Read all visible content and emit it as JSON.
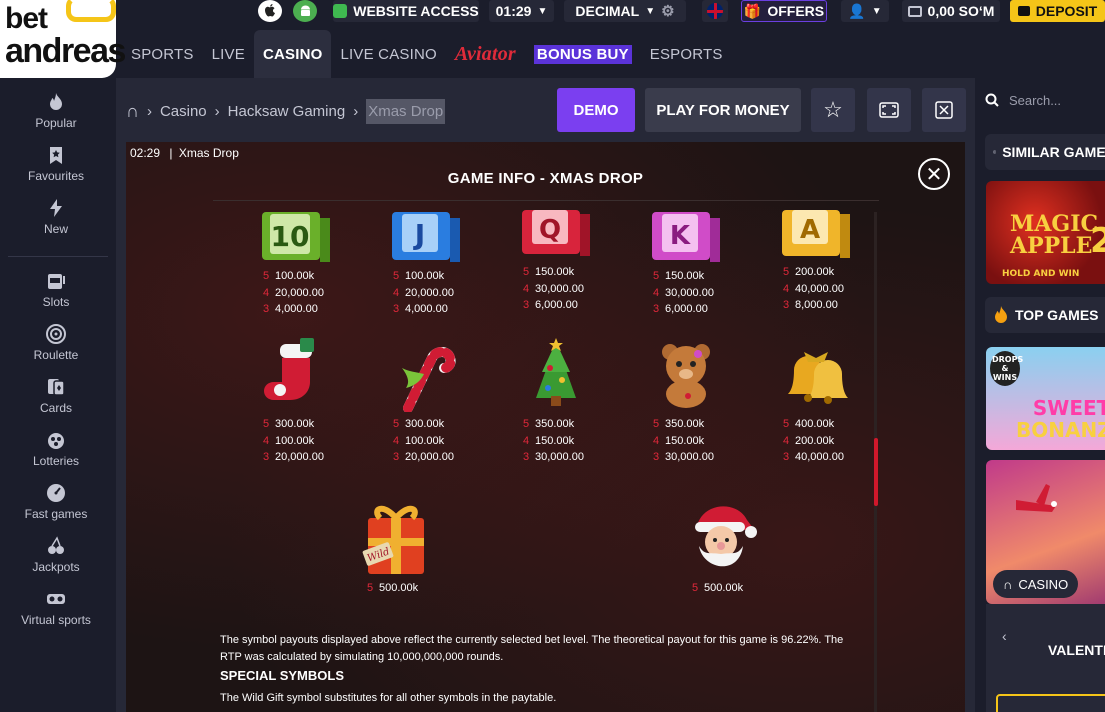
{
  "brand": {
    "logo_top": "bet",
    "logo_bottom": "andreas"
  },
  "topbar": {
    "website_access": "WEBSITE ACCESS",
    "clock": "01:29",
    "odds_format": "DECIMAL",
    "offers": "OFFERS",
    "balance": "0,00 SOʻM",
    "deposit": "DEPOSIT"
  },
  "nav": {
    "sports": "SPORTS",
    "live": "LIVE",
    "casino": "CASINO",
    "live_casino": "LIVE CASINO",
    "aviator": "Aviator",
    "bonus_buy": "BONUS BUY",
    "esports": "ESPORTS"
  },
  "sidebar": {
    "items": [
      {
        "label": "Popular",
        "icon": "fire-icon"
      },
      {
        "label": "Favourites",
        "icon": "bookmark-icon"
      },
      {
        "label": "New",
        "icon": "lightning-icon"
      },
      {
        "label": "Slots",
        "icon": "slot-machine-icon"
      },
      {
        "label": "Roulette",
        "icon": "roulette-icon"
      },
      {
        "label": "Cards",
        "icon": "cards-icon"
      },
      {
        "label": "Lotteries",
        "icon": "lottery-icon"
      },
      {
        "label": "Fast games",
        "icon": "speedometer-icon"
      },
      {
        "label": "Jackpots",
        "icon": "cherries-icon"
      },
      {
        "label": "Virtual sports",
        "icon": "vr-headset-icon"
      }
    ]
  },
  "breadcrumb": {
    "casino": "Casino",
    "provider": "Hacksaw Gaming",
    "game": "Xmas Drop"
  },
  "actions": {
    "demo": "DEMO",
    "play": "PLAY FOR MONEY"
  },
  "game": {
    "timer": "02:29",
    "separator": "|",
    "name": "Xmas Drop",
    "info_title": "GAME INFO - XMAS DROP",
    "row1": [
      {
        "symbol": "10",
        "p5": "100.00k",
        "p4": "20,000.00",
        "p3": "4,000.00",
        "color": "#6ab02a"
      },
      {
        "symbol": "J",
        "p5": "100.00k",
        "p4": "20,000.00",
        "p3": "4,000.00",
        "color": "#2a7de0"
      },
      {
        "symbol": "Q",
        "p5": "150.00k",
        "p4": "30,000.00",
        "p3": "6,000.00",
        "color": "#d8243c"
      },
      {
        "symbol": "K",
        "p5": "150.00k",
        "p4": "30,000.00",
        "p3": "6,000.00",
        "color": "#d04cc8"
      },
      {
        "symbol": "A",
        "p5": "200.00k",
        "p4": "40,000.00",
        "p3": "8,000.00",
        "color": "#f0b52a"
      }
    ],
    "row2": [
      {
        "symbol": "stocking",
        "p5": "300.00k",
        "p4": "100.00k",
        "p3": "20,000.00"
      },
      {
        "symbol": "candy-cane",
        "p5": "300.00k",
        "p4": "100.00k",
        "p3": "20,000.00"
      },
      {
        "symbol": "tree",
        "p5": "350.00k",
        "p4": "150.00k",
        "p3": "30,000.00"
      },
      {
        "symbol": "teddy-bear",
        "p5": "350.00k",
        "p4": "150.00k",
        "p3": "30,000.00"
      },
      {
        "symbol": "bells",
        "p5": "400.00k",
        "p4": "200.00k",
        "p3": "40,000.00"
      }
    ],
    "row3": [
      {
        "symbol": "gift",
        "gift_text": "Wild",
        "p5": "500.00k"
      },
      {
        "symbol": "santa",
        "p5": "500.00k"
      }
    ],
    "description": "The symbol payouts displayed above reflect the currently selected bet level. The theoretical payout for this game is 96.22%. The RTP was calculated by simulating 10,000,000,000 rounds.",
    "special_title": "SPECIAL SYMBOLS",
    "wild_desc": "The Wild Gift symbol substitutes for all other symbols in the paytable.",
    "keys": {
      "k5": "5",
      "k4": "4",
      "k3": "3"
    }
  },
  "right": {
    "search_placeholder": "Search...",
    "similar": "SIMILAR GAMES",
    "top_games": "TOP GAMES",
    "thumb1": {
      "line1": "MAGIC",
      "line2": "APPLE",
      "num": "2",
      "sub": "HOLD AND WIN"
    },
    "thumb2": {
      "badge": "DROPS & WINS",
      "line1": "SWEET",
      "line2": "BONANZA"
    },
    "casino_tag": "CASINO",
    "promo": "VALENTI"
  }
}
